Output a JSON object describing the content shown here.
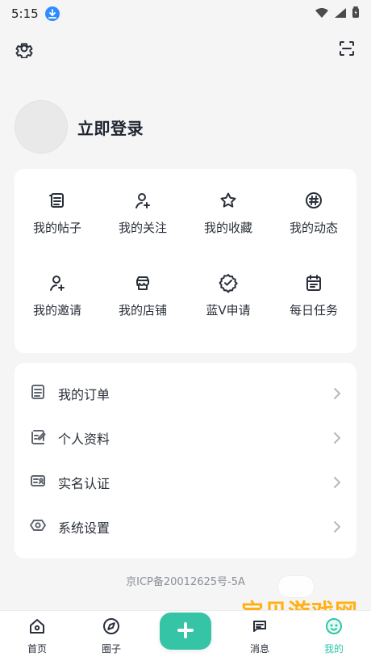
{
  "status_bar": {
    "time": "5:15"
  },
  "profile": {
    "login_label": "立即登录"
  },
  "quick_actions": [
    {
      "label": "我的帖子",
      "icon": "posts-icon"
    },
    {
      "label": "我的关注",
      "icon": "follow-user-icon"
    },
    {
      "label": "我的收藏",
      "icon": "star-icon"
    },
    {
      "label": "我的动态",
      "icon": "hash-icon"
    },
    {
      "label": "我的邀请",
      "icon": "invite-user-icon"
    },
    {
      "label": "我的店铺",
      "icon": "shop-icon"
    },
    {
      "label": "蓝V申请",
      "icon": "verified-badge-icon"
    },
    {
      "label": "每日任务",
      "icon": "calendar-icon"
    }
  ],
  "menu": [
    {
      "label": "我的订单",
      "icon": "orders-icon"
    },
    {
      "label": "个人资料",
      "icon": "edit-profile-icon"
    },
    {
      "label": "实名认证",
      "icon": "id-card-icon"
    },
    {
      "label": "系统设置",
      "icon": "settings-hex-icon"
    }
  ],
  "icp": "京ICP备20012625号-5A",
  "bottom_nav": [
    {
      "label": "首页",
      "icon": "home-icon"
    },
    {
      "label": "圈子",
      "icon": "compass-icon"
    },
    {
      "label": "",
      "icon": "plus-icon"
    },
    {
      "label": "消息",
      "icon": "chat-icon"
    },
    {
      "label": "我的",
      "icon": "profile-icon"
    }
  ],
  "watermark": {
    "title": "宝贝游戏网",
    "url": "baobeiy.com"
  },
  "colors": {
    "accent": "#35c4a5",
    "active_nav": "#2fc7a8",
    "background": "#f5f5f5",
    "card": "#ffffff"
  }
}
